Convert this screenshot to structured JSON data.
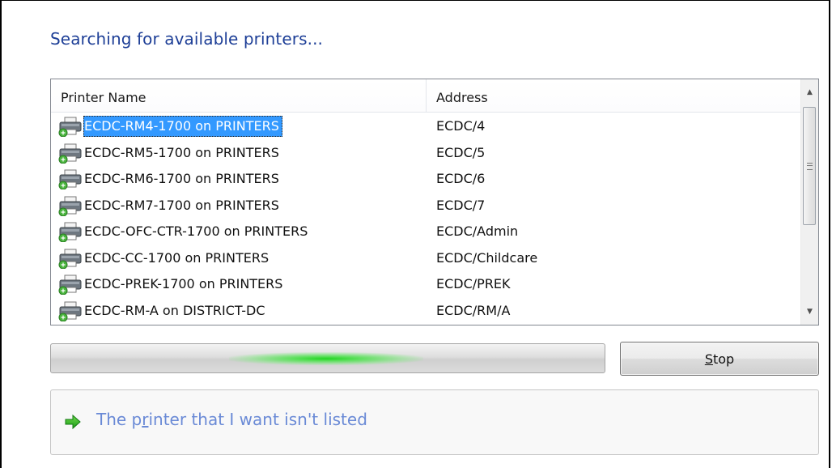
{
  "heading": "Searching for available printers...",
  "list": {
    "columns": {
      "name": "Printer Name",
      "address": "Address"
    },
    "rows": [
      {
        "name": "ECDC-RM4-1700 on PRINTERS",
        "address": "ECDC/4",
        "selected": true
      },
      {
        "name": "ECDC-RM5-1700 on PRINTERS",
        "address": "ECDC/5"
      },
      {
        "name": "ECDC-RM6-1700 on PRINTERS",
        "address": "ECDC/6"
      },
      {
        "name": "ECDC-RM7-1700 on PRINTERS",
        "address": "ECDC/7"
      },
      {
        "name": "ECDC-OFC-CTR-1700 on PRINTERS",
        "address": "ECDC/Admin"
      },
      {
        "name": "ECDC-CC-1700 on PRINTERS",
        "address": "ECDC/Childcare"
      },
      {
        "name": "ECDC-PREK-1700 on PRINTERS",
        "address": "ECDC/PREK"
      },
      {
        "name": "ECDC-RM-A on DISTRICT-DC",
        "address": "ECDC/RM/A"
      }
    ],
    "row_icon": "printer-icon"
  },
  "stop_button": {
    "label_prefix": "",
    "label_mnemonic": "S",
    "label_rest": "top"
  },
  "not_listed": {
    "icon": "green-arrow-icon",
    "text_before": "The p",
    "text_mnemonic": "r",
    "text_after": "inter that I want isn't listed"
  },
  "colors": {
    "heading": "#1e3f97",
    "link": "#6a8ad6",
    "selection": "#3399ff",
    "progress": "#22d422"
  }
}
